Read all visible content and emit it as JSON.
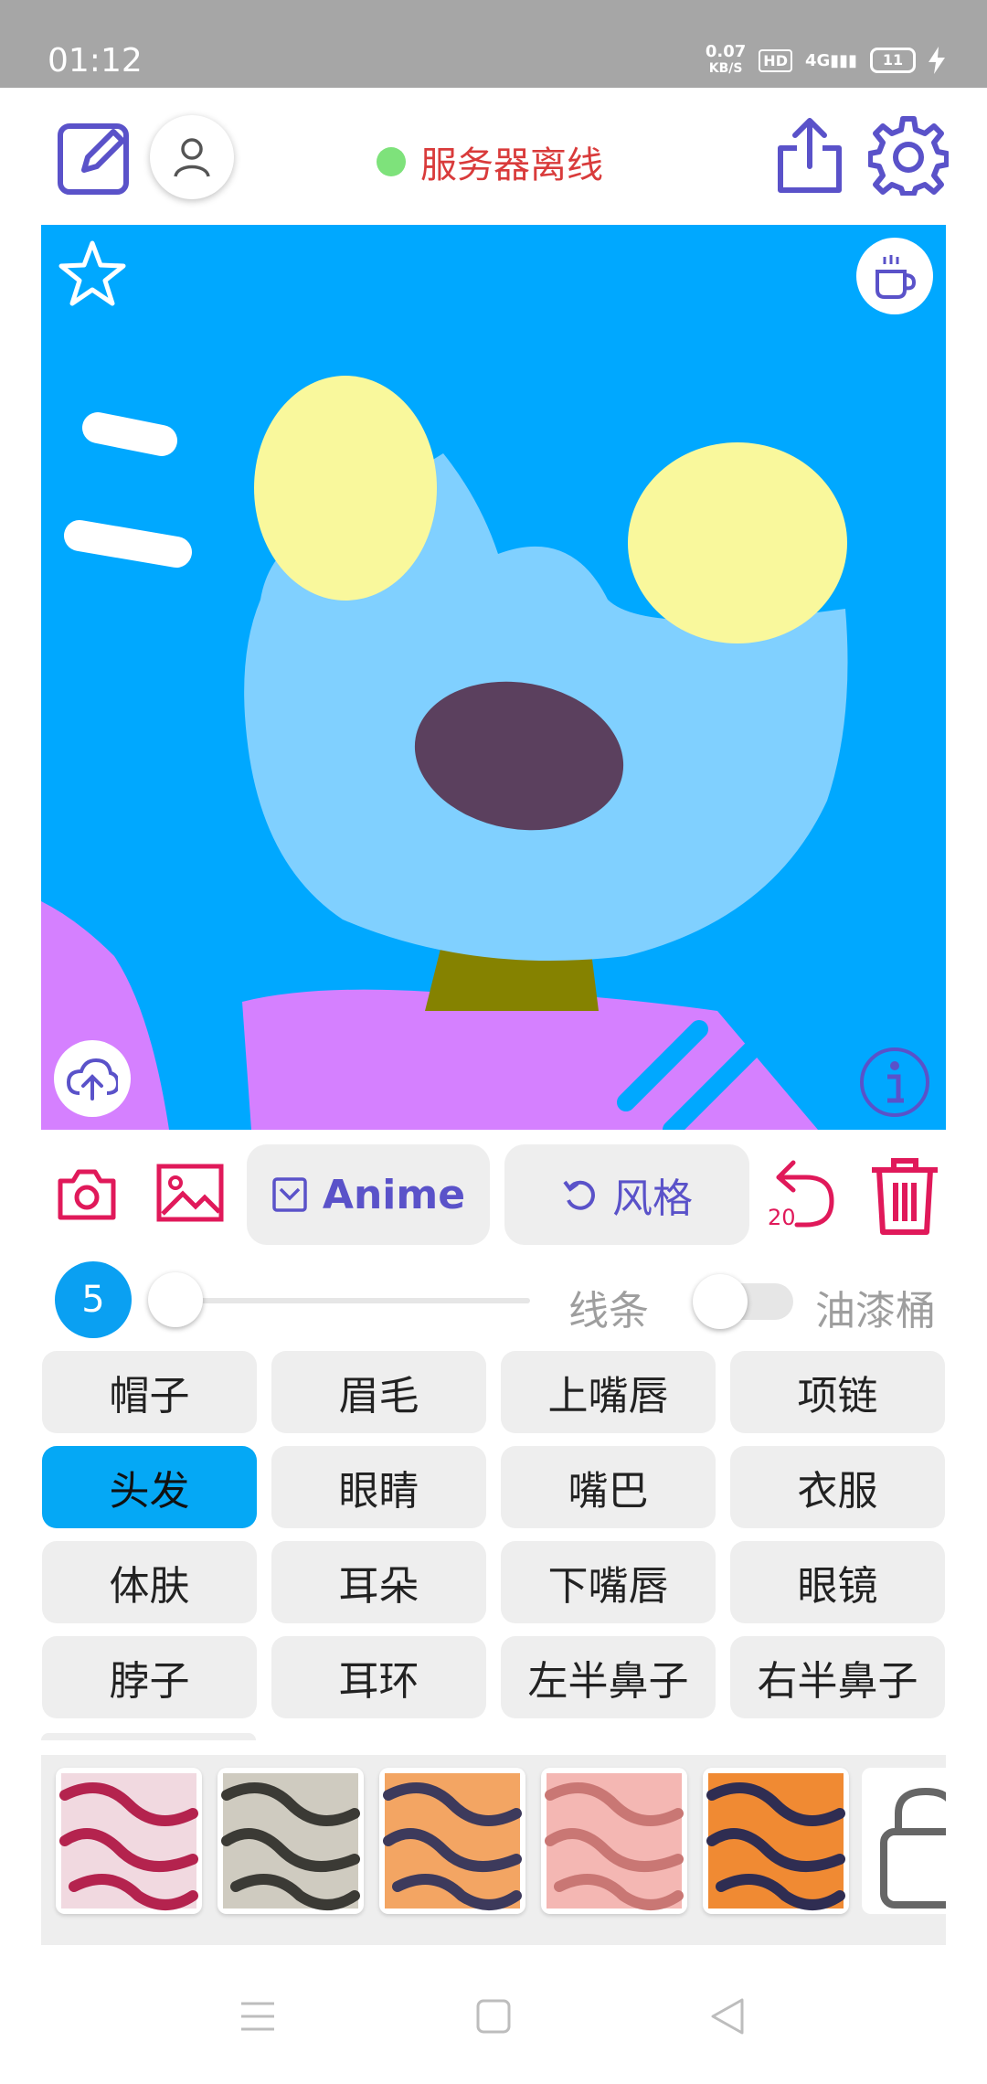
{
  "status_bar": {
    "time": "01:12",
    "net_speed": "0.07",
    "net_unit": "KB/S",
    "hd": "HD",
    "network": "4G",
    "battery": "11"
  },
  "header": {
    "server_status": "服务器离线",
    "status_color": "#7ee27b"
  },
  "colors": {
    "accent": "#5a52c9",
    "danger": "#e0195a",
    "selected": "#05a8f5",
    "canvas_bg": "#00a8ff"
  },
  "toolbar": {
    "anime_label": "Anime",
    "style_label": "风格",
    "undo_count": "20"
  },
  "brush": {
    "size": "5",
    "lines_label": "线条",
    "bucket_label": "油漆桶",
    "bucket_enabled": false
  },
  "parts": [
    {
      "label": "帽子",
      "selected": false
    },
    {
      "label": "眉毛",
      "selected": false
    },
    {
      "label": "上嘴唇",
      "selected": false
    },
    {
      "label": "项链",
      "selected": false
    },
    {
      "label": "头发",
      "selected": true
    },
    {
      "label": "眼睛",
      "selected": false
    },
    {
      "label": "嘴巴",
      "selected": false
    },
    {
      "label": "衣服",
      "selected": false
    },
    {
      "label": "体肤",
      "selected": false
    },
    {
      "label": "耳朵",
      "selected": false
    },
    {
      "label": "下嘴唇",
      "selected": false
    },
    {
      "label": "眼镜",
      "selected": false
    },
    {
      "label": "脖子",
      "selected": false
    },
    {
      "label": "耳环",
      "selected": false
    },
    {
      "label": "左半鼻子",
      "selected": false
    },
    {
      "label": "右半鼻子",
      "selected": false
    }
  ],
  "textures": [
    {
      "name": "pink-crimson",
      "base": "#f1d9e0",
      "stroke": "#b4234e"
    },
    {
      "name": "grey-marble",
      "base": "#cfcbc0",
      "stroke": "#3b3a35"
    },
    {
      "name": "orange-tiger",
      "base": "#f3a563",
      "stroke": "#3d3a5c"
    },
    {
      "name": "pink-skin",
      "base": "#f4b7b3",
      "stroke": "#c97774"
    },
    {
      "name": "dark-tiger",
      "base": "#f08a33",
      "stroke": "#2f2d52"
    }
  ]
}
